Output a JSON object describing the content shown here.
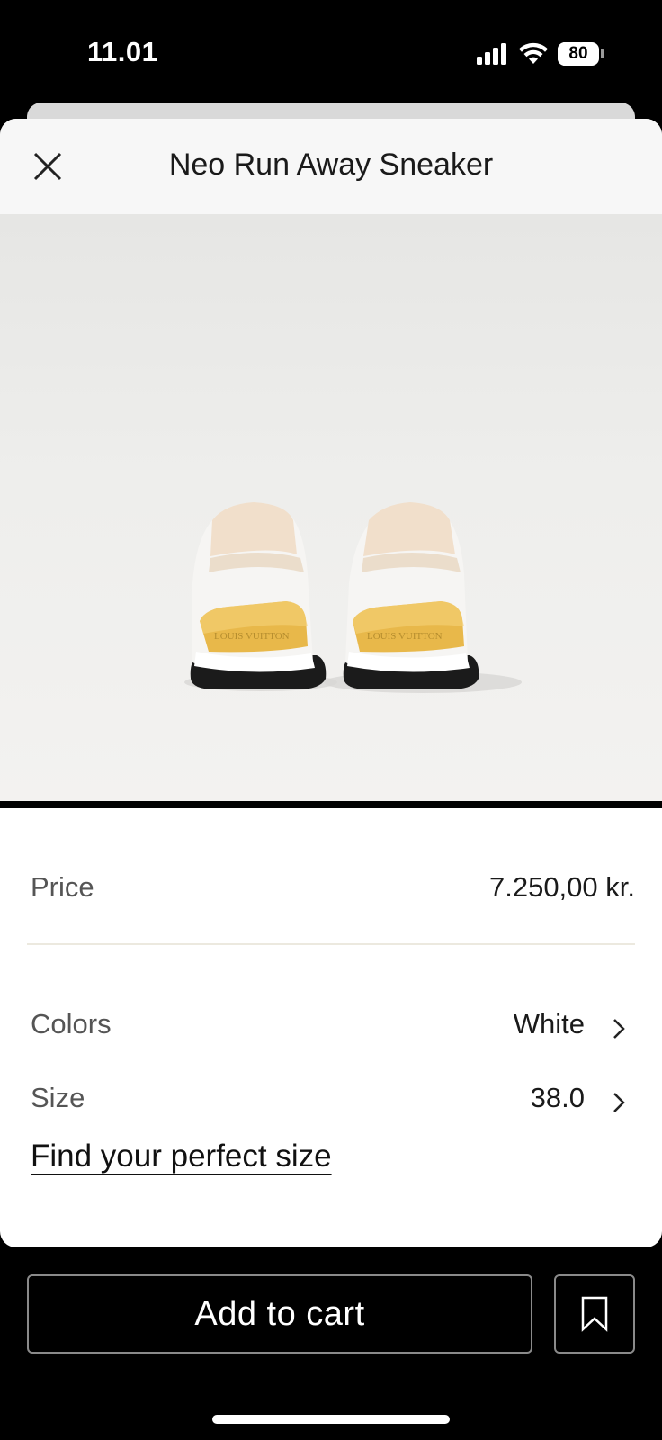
{
  "status_bar": {
    "time": "11.01",
    "battery": "80",
    "battery_level": 0.8
  },
  "header": {
    "title": "Neo Run Away Sneaker",
    "close_icon": "close-icon"
  },
  "product": {
    "image_alt": "product-image",
    "brand_mark": "LOUIS VUITTON"
  },
  "details": {
    "price_label": "Price",
    "price_value": "7.250,00 kr.",
    "colors_label": "Colors",
    "colors_value": "White",
    "size_label": "Size",
    "size_value": "38.0",
    "size_guide_link": "Find your perfect size"
  },
  "actions": {
    "add_to_cart": "Add to cart",
    "wishlist_icon": "bookmark-icon"
  },
  "colors": {
    "accent_gold": "#e8b84a",
    "sheet_background": "#ffffff",
    "app_background": "#000000"
  }
}
